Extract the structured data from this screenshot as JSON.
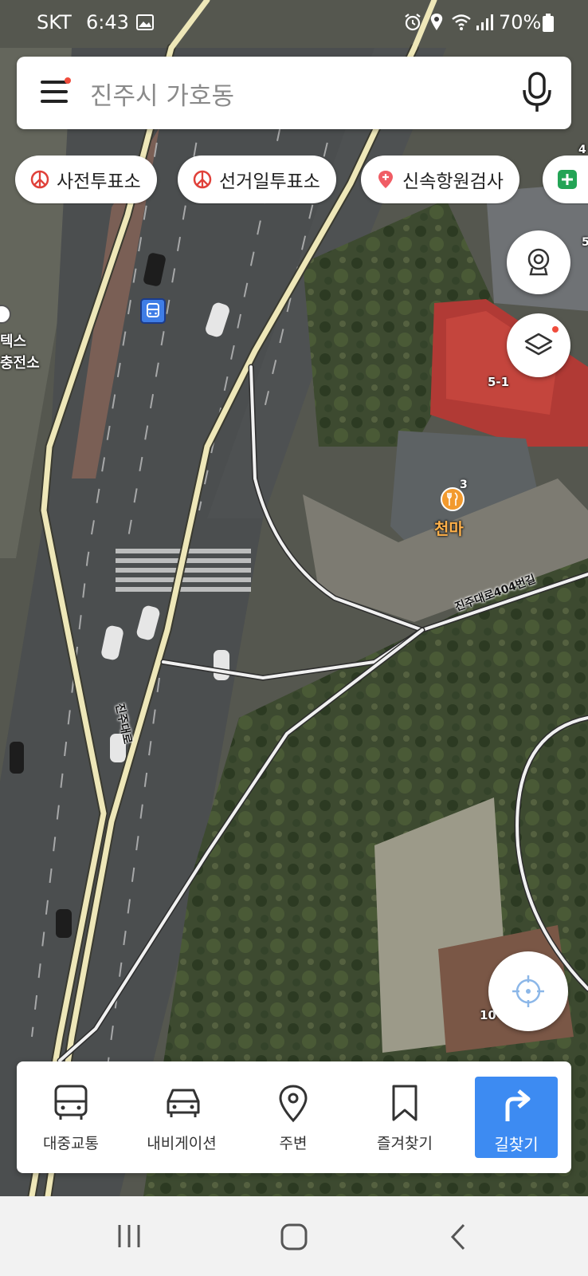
{
  "status_bar": {
    "carrier": "SKT",
    "time": "6:43",
    "battery": "70%"
  },
  "search": {
    "query": "진주시 가호동"
  },
  "chips": [
    {
      "label": "사전투표소",
      "icon": "vote-icon"
    },
    {
      "label": "선거일투표소",
      "icon": "vote-icon"
    },
    {
      "label": "신속항원검사",
      "icon": "medical-pin-icon"
    },
    {
      "label": "",
      "icon": "plus-icon"
    }
  ],
  "map": {
    "place_labels": [
      "텍스",
      "충전소"
    ],
    "road_labels": [
      "진주대로",
      "진주대로404번길"
    ],
    "address_labels": [
      "5-1",
      "10"
    ],
    "poi": {
      "name": "천마",
      "count": "3",
      "icon": "restaurant-icon"
    },
    "edge_numbers": [
      "4",
      "5"
    ]
  },
  "bottom_nav": [
    {
      "label": "대중교통",
      "icon": "bus-icon"
    },
    {
      "label": "내비게이션",
      "icon": "car-icon"
    },
    {
      "label": "주변",
      "icon": "location-pin-icon"
    },
    {
      "label": "즐겨찾기",
      "icon": "bookmark-icon"
    }
  ],
  "route_button": {
    "label": "길찾기",
    "icon": "turn-right-arrow-icon"
  },
  "colors": {
    "accent": "#3d8bf2",
    "poi": "#f29a2e",
    "alert_dot": "#f04c3c"
  }
}
